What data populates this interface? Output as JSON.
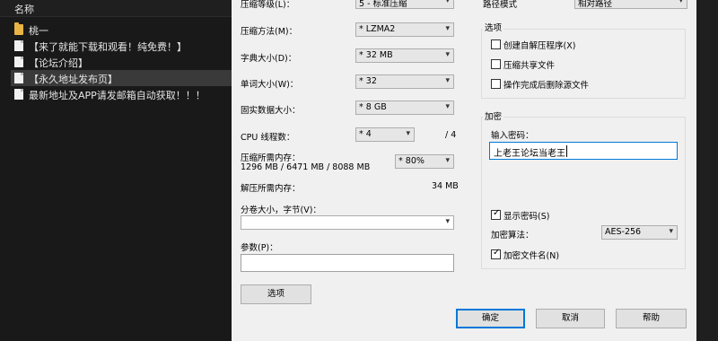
{
  "explorer": {
    "header": "名称",
    "items": [
      {
        "name": "桃一",
        "icon": "folder-icon"
      },
      {
        "name": "【来了就能下载和观看！纯免费！】",
        "icon": "file-icon"
      },
      {
        "name": "【论坛介绍】",
        "icon": "file-icon"
      },
      {
        "name": "【永久地址发布页】",
        "icon": "file-icon"
      },
      {
        "name": "最新地址及APP请发邮箱自动获取！！！",
        "icon": "file-icon"
      }
    ]
  },
  "dialog": {
    "compression_level": {
      "label": "压缩等级(L)：",
      "value": "5 - 标准压缩"
    },
    "path_mode": {
      "label": "路径模式",
      "value": "相对路径"
    },
    "method": {
      "label": "压缩方法(M)：",
      "value": "* LZMA2"
    },
    "dict_size": {
      "label": "字典大小(D)：",
      "value": "* 32 MB"
    },
    "word_size": {
      "label": "单词大小(W)：",
      "value": "* 32"
    },
    "solid_block": {
      "label": "固实数据大小：",
      "value": "* 8 GB"
    },
    "cpu_threads": {
      "label": "CPU 线程数：",
      "value": "* 4",
      "max": "/ 4"
    },
    "mem_compress": {
      "label": "压缩所需内存：",
      "detail": "1296 MB / 6471 MB / 8088 MB",
      "value": "* 80%"
    },
    "mem_decompress": {
      "label": "解压所需内存：",
      "value": "34 MB"
    },
    "split": {
      "label": "分卷大小，字节(V)：",
      "value": ""
    },
    "params": {
      "label": "参数(P)：",
      "value": ""
    },
    "options_button": "选项",
    "options_group": {
      "title": "选项",
      "sfx": "创建自解压程序(X)",
      "shared": "压缩共享文件",
      "delete_after": "操作完成后删除源文件"
    },
    "encryption": {
      "title": "加密",
      "pwd_label": "输入密码：",
      "pwd_value": "上老王论坛当老王",
      "show_pwd": "显示密码(S)",
      "method_label": "加密算法：",
      "method_value": "AES-256",
      "encrypt_names": "加密文件名(N)"
    },
    "buttons": {
      "ok": "确定",
      "cancel": "取消",
      "help": "帮助"
    }
  }
}
